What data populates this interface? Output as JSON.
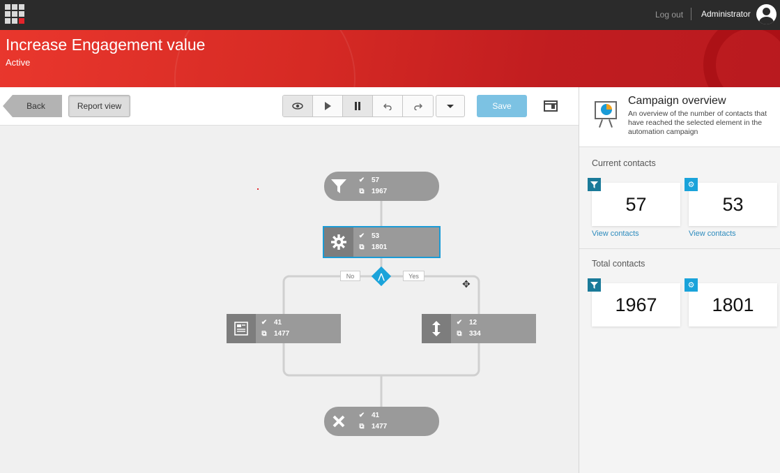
{
  "topbar": {
    "logout": "Log out",
    "user": "Administrator"
  },
  "header": {
    "title": "Increase Engagement value",
    "status": "Active"
  },
  "toolbar": {
    "back": "Back",
    "report_view": "Report view",
    "save": "Save"
  },
  "canvas": {
    "nodes": [
      {
        "id": "trigger",
        "icon": "funnel-icon",
        "contacts": "57",
        "total": "1967"
      },
      {
        "id": "action",
        "icon": "gear-icon",
        "contacts": "53",
        "total": "1801"
      },
      {
        "id": "no-branch",
        "icon": "document-icon",
        "contacts": "41",
        "total": "1477"
      },
      {
        "id": "yes-branch",
        "icon": "updown-arrow-icon",
        "contacts": "12",
        "total": "334"
      },
      {
        "id": "end",
        "icon": "close-icon",
        "contacts": "41",
        "total": "1477"
      }
    ],
    "condition": {
      "no": "No",
      "yes": "Yes"
    }
  },
  "panel": {
    "title": "Campaign overview",
    "description": "An overview of the number of contacts that have reached the selected element in the automation campaign",
    "current_label": "Current contacts",
    "total_label": "Total contacts",
    "current": [
      {
        "icon": "funnel-icon",
        "value": "57",
        "link": "View contacts"
      },
      {
        "icon": "gear-icon",
        "value": "53",
        "link": "View contacts"
      }
    ],
    "total": [
      {
        "icon": "funnel-icon",
        "value": "1967"
      },
      {
        "icon": "gear-icon",
        "value": "1801"
      }
    ]
  },
  "colors": {
    "header_red": "#d62a24",
    "selection_blue": "#1a9bd6",
    "node_gray": "#9a9a9a",
    "save_blue": "#7cc2e3"
  }
}
